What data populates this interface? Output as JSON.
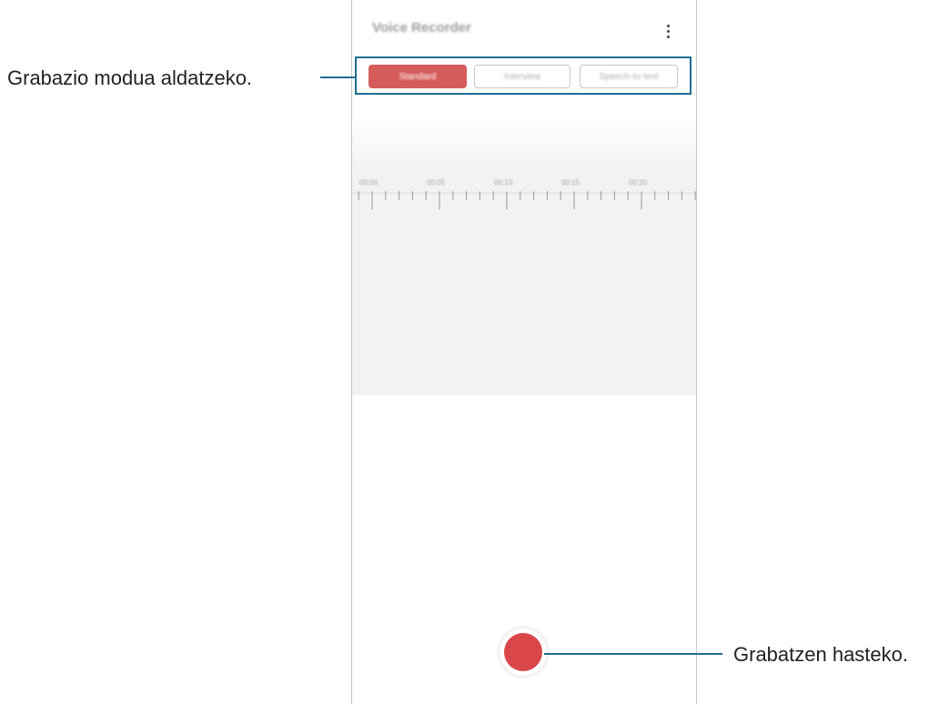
{
  "app": {
    "title": "Voice Recorder",
    "more_icon": "more-vertical-icon"
  },
  "mode_tabs": [
    {
      "label": "Standard",
      "active": true
    },
    {
      "label": "Interview",
      "active": false
    },
    {
      "label": "Speech-to-text",
      "active": false
    }
  ],
  "timeline": {
    "time_labels": [
      "00:00",
      "00:05",
      "00:10",
      "00:15",
      "00:20"
    ]
  },
  "record_button": {
    "icon": "record-icon",
    "color": "#d9474a"
  },
  "callouts": {
    "mode_switch": "Grabazio modua aldatzeko.",
    "start_recording": "Grabatzen hasteko."
  },
  "colors": {
    "accent": "#d65c5c",
    "callout_line": "#1f6e90",
    "timeline_bg": "#f3f1f1"
  }
}
